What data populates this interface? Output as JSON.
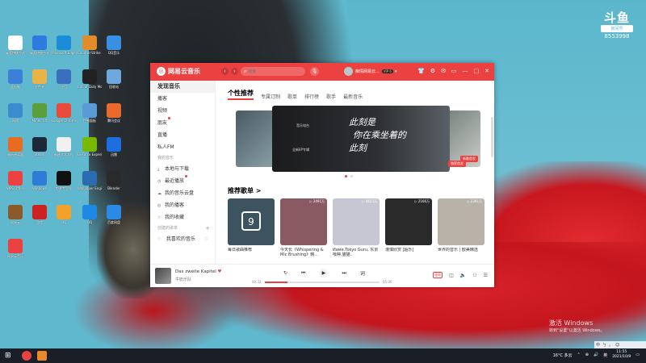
{
  "desktop": {
    "icons": [
      {
        "label": "桌面快捷方式",
        "color": "#ffffff"
      },
      {
        "label": "桌面快捷方式",
        "color": "#2d7be0"
      },
      {
        "label": "Microsoft Edge",
        "color": "#1b8dd8"
      },
      {
        "label": "Counter-Strike Global Offensive",
        "color": "#e08c2a"
      },
      {
        "label": "QQ音乐",
        "color": "#3a8fe0"
      },
      {
        "label": "此电脑",
        "color": "#3b7fd9"
      },
      {
        "label": "文件夹",
        "color": "#e8b44a"
      },
      {
        "label": "应用",
        "color": "#3a6fbf"
      },
      {
        "label": "Call of Duty Modern Warfare",
        "color": "#222222"
      },
      {
        "label": "回收站",
        "color": "#6fa8dc"
      },
      {
        "label": "网络",
        "color": "#3b8bd0"
      },
      {
        "label": "Minecraft",
        "color": "#5c9e3b"
      },
      {
        "label": "Google Chrome",
        "color": "#e94b3c"
      },
      {
        "label": "控制面板",
        "color": "#5b9bd5"
      },
      {
        "label": "腾讯会议",
        "color": "#e86b2d"
      },
      {
        "label": "福昕阅读器",
        "color": "#e96b1f"
      },
      {
        "label": "Steam",
        "color": "#1a2838"
      },
      {
        "label": "新建文本文档",
        "color": "#f0f0f0"
      },
      {
        "label": "GeForce Experience",
        "color": "#76b900"
      },
      {
        "label": "迅雷",
        "color": "#1d6fe0"
      },
      {
        "label": "WPS Office",
        "color": "#ec4141"
      },
      {
        "label": "Windows",
        "color": "#2c7cd8"
      },
      {
        "label": "剪映专业版",
        "color": "#111111"
      },
      {
        "label": "Wallpaper Engine",
        "color": "#2b6cb0"
      },
      {
        "label": "Blender",
        "color": "#2a2a2a"
      },
      {
        "label": "网易云",
        "color": "#8b5a2b"
      },
      {
        "label": "游戏",
        "color": "#c22"
      },
      {
        "label": "QQ",
        "color": "#f2a12b"
      },
      {
        "label": "QQ",
        "color": "#1e88e5"
      },
      {
        "label": "百度网盘",
        "color": "#2b8ae6"
      },
      {
        "label": "网易云音乐",
        "color": "#ec4141"
      }
    ],
    "watermark": {
      "logo": "斗鱼",
      "sub": "房间号",
      "num": "8553998"
    },
    "activate": {
      "line1": "激活 Windows",
      "line2": "转到\"设置\"以激活 Windows。"
    }
  },
  "app": {
    "name": "网易云音乐",
    "search_placeholder": "搜索",
    "user_name": "痴情网易云...",
    "vip": "VIP 6",
    "accent": "#ec4141"
  },
  "sidebar": {
    "items": [
      {
        "label": "发现音乐",
        "active": true
      },
      {
        "label": "播客"
      },
      {
        "label": "视频"
      },
      {
        "label": "朋友",
        "dot": true
      },
      {
        "label": "直播"
      },
      {
        "label": "私人FM"
      }
    ],
    "my_music_header": "我的音乐",
    "my_items": [
      {
        "label": "本地与下载",
        "icon": "⤓"
      },
      {
        "label": "最近播放",
        "icon": "◷",
        "dot": true
      },
      {
        "label": "我的音乐云盘",
        "icon": "☁"
      },
      {
        "label": "我的播客",
        "icon": "◎"
      },
      {
        "label": "我的收藏",
        "icon": "☆"
      }
    ],
    "created_header": "创建的歌单",
    "liked": "我喜欢的音乐"
  },
  "tabs": [
    "个性推荐",
    "专属订制",
    "歌单",
    "排行榜",
    "歌手",
    "最新音乐"
  ],
  "banner": {
    "line1": "此刻是",
    "line2": "你在乘坐着的",
    "line3": "此刻",
    "small1": "音乐电台",
    "small2": "全新EP专辑",
    "tag": "独家首发",
    "tag2": "新歌首发"
  },
  "playlist_section": "推荐歌单 >",
  "playlists": [
    {
      "title": "每日歌曲推荐",
      "count": "",
      "icon_day": "9",
      "bg": "#3e5360"
    },
    {
      "title": "今天长《Whispering & Mic Brushing》韩...",
      "count": "▷ 2491万",
      "bg": "#8a5a63"
    },
    {
      "title": "Иамe.Tokyo Guru, 东京喰种,猫猫..",
      "count": "▷ 4423万",
      "bg": "#c7c7d3"
    },
    {
      "title": "谨慎欣赏 [超乐]",
      "count": "▷ 2166万",
      "bg": "#2a2a2a"
    },
    {
      "title": "世界的音乐 | 欧美精选",
      "count": "▷ 2391万",
      "bg": "#b9b2a8"
    }
  ],
  "player": {
    "title": "Das zweite Kapitel",
    "artist": "牛奶乐队",
    "time_current": "00:32",
    "time_total": "05:00",
    "progress": 0.2,
    "quality": "极高"
  },
  "taskbar": {
    "weather": "16°C 多云",
    "time": "11:55",
    "date": "2021/10/9",
    "ime": [
      "中",
      "ㄅ",
      "。",
      "☺"
    ]
  }
}
